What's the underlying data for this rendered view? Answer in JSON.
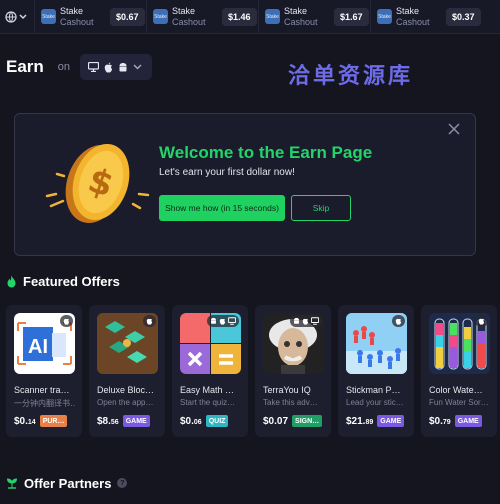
{
  "ticker": {
    "items": [
      {
        "thumb": "Stake",
        "name": "Stake",
        "sub": "Cashout",
        "amount": "$0.67"
      },
      {
        "thumb": "Stake",
        "name": "Stake",
        "sub": "Cashout",
        "amount": "$1.46"
      },
      {
        "thumb": "Stake",
        "name": "Stake",
        "sub": "Cashout",
        "amount": "$1.67"
      },
      {
        "thumb": "Stake",
        "name": "Stake",
        "sub": "Cashout",
        "amount": "$0.37"
      }
    ]
  },
  "header": {
    "title": "Earn",
    "on_label": "on",
    "watermark": "洽单资源库"
  },
  "welcome": {
    "title": "Welcome to the Earn Page",
    "subtitle": "Let's earn your first dollar now!",
    "primary_label": "Show me how (in 15 seconds)",
    "skip_label": "Skip"
  },
  "featured": {
    "title": "Featured Offers",
    "offers": [
      {
        "name": "Scanner tra…",
        "desc": "一分钟内翻译书…",
        "price": "$0.",
        "cents": "14",
        "tag": "PUR…",
        "tag_color": "#e8804a"
      },
      {
        "name": "Deluxe Bloc…",
        "desc": "Open the app…",
        "price": "$8.",
        "cents": "56",
        "tag": "GAME",
        "tag_color": "#7a5ae0"
      },
      {
        "name": "Easy Math …",
        "desc": "Start the quiz…",
        "price": "$0.",
        "cents": "06",
        "tag": "QUIZ",
        "tag_color": "#2fb6c4"
      },
      {
        "name": "TerraYou IQ",
        "desc": "Take this adv…",
        "price": "$0.07",
        "cents": "",
        "tag": "SIGN…",
        "tag_color": "#1f9e66"
      },
      {
        "name": "Stickman P…",
        "desc": "Lead your stic…",
        "price": "$21.",
        "cents": "89",
        "tag": "GAME",
        "tag_color": "#7a5ae0"
      },
      {
        "name": "Color Wate…",
        "desc": "Fun Water Sor…",
        "price": "$0.",
        "cents": "79",
        "tag": "GAME",
        "tag_color": "#7a5ae0"
      }
    ]
  },
  "partners": {
    "title": "Offer Partners"
  },
  "colors": {
    "accent_green": "#22d46a",
    "background": "#14151f",
    "card": "#1d1e2e"
  }
}
